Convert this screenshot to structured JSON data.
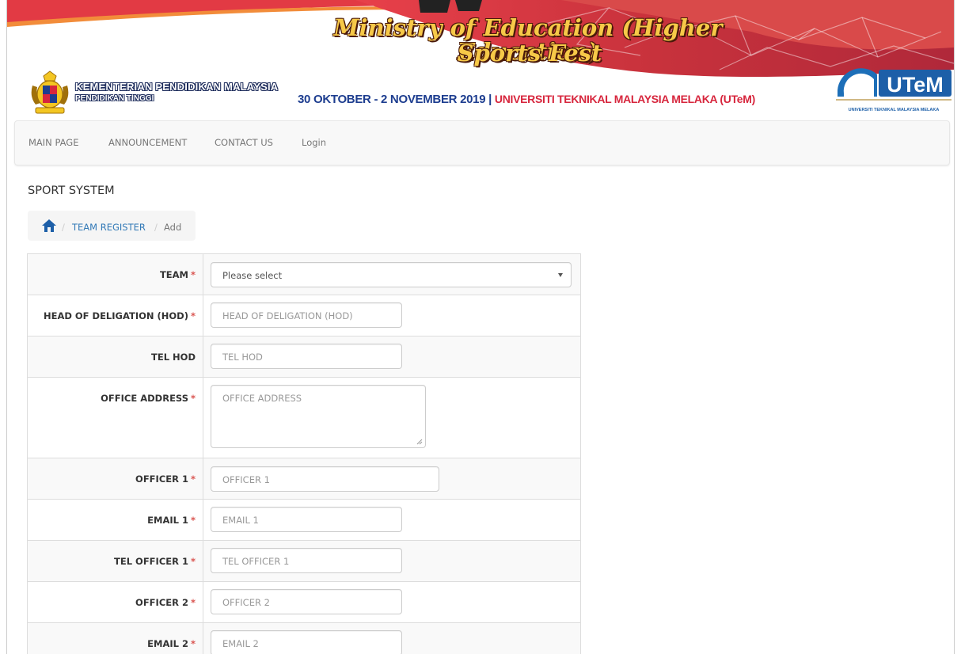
{
  "banner": {
    "title_line1": "Ministry of Education (Higher Education)",
    "title_line2": "Sports Fest",
    "ministry_name": "KEMENTERIAN PENDIDIKAN MALAYSIA",
    "ministry_sub": "PENDIDIKAN TINGGI",
    "event_dates": "30 OKTOBER - 2 NOVEMBER 2019",
    "event_separator": "|",
    "event_venue": "UNIVERSITI TEKNIKAL MALAYSIA MELAKA (UTeM)",
    "utem_logo_text": "UTeM",
    "utem_logo_caption": "UNIVERSITI TEKNIKAL MALAYSIA MELAKA",
    "colors": {
      "banner_red": "#c8323c",
      "title_gold": "#f7c948",
      "date_blue": "#1d3d8f",
      "venue_red": "#d7263d"
    }
  },
  "nav": {
    "items": [
      {
        "label": "MAIN PAGE"
      },
      {
        "label": "ANNOUNCEMENT"
      },
      {
        "label": "CONTACT US"
      },
      {
        "label": "Login"
      }
    ]
  },
  "page": {
    "heading": "SPORT SYSTEM"
  },
  "breadcrumb": {
    "home_icon": "home-icon",
    "separator": "/",
    "link": "TEAM REGISTER",
    "active": "Add"
  },
  "form": {
    "required_marker": "*",
    "fields": [
      {
        "label": "TEAM",
        "required": true,
        "type": "select",
        "value": "Please select"
      },
      {
        "label": "HEAD OF DELIGATION (HOD)",
        "required": true,
        "type": "text",
        "placeholder": "HEAD OF DELIGATION (HOD)"
      },
      {
        "label": "TEL HOD",
        "required": false,
        "type": "text",
        "placeholder": "TEL HOD"
      },
      {
        "label": "OFFICE ADDRESS",
        "required": true,
        "type": "textarea",
        "placeholder": "OFFICE ADDRESS"
      },
      {
        "label": "OFFICER 1",
        "required": true,
        "type": "text",
        "placeholder": "OFFICER 1"
      },
      {
        "label": "EMAIL 1",
        "required": true,
        "type": "text",
        "placeholder": "EMAIL 1"
      },
      {
        "label": "TEL OFFICER 1",
        "required": true,
        "type": "text",
        "placeholder": "TEL OFFICER 1"
      },
      {
        "label": "OFFICER 2",
        "required": true,
        "type": "text",
        "placeholder": "OFFICER 2"
      },
      {
        "label": "EMAIL 2",
        "required": true,
        "type": "text",
        "placeholder": "EMAIL 2"
      }
    ]
  }
}
